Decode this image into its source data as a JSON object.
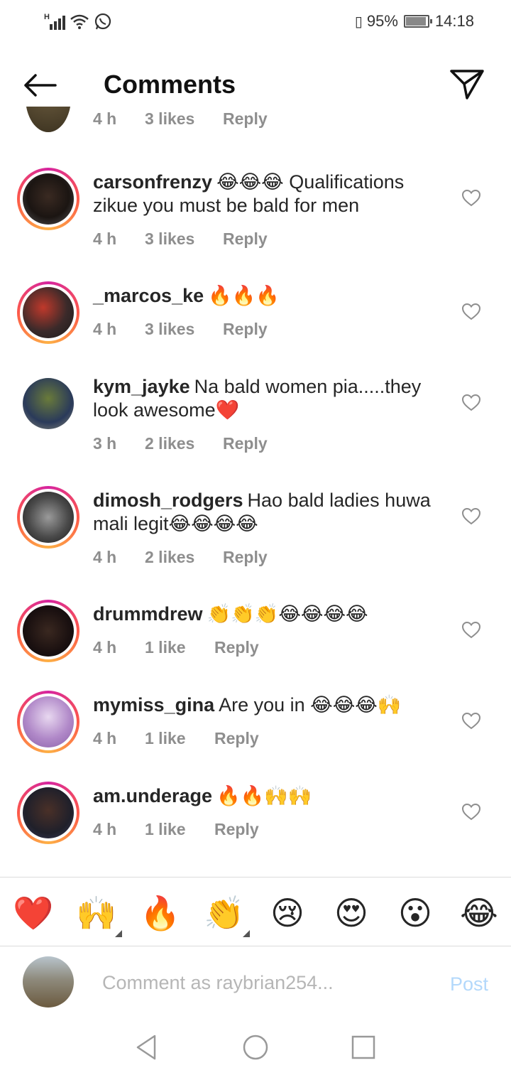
{
  "status_bar": {
    "battery_percent": "95%",
    "time": "14:18",
    "battery_level": 0.95,
    "icons": [
      "signal-icon",
      "wifi-icon",
      "whatsapp-icon",
      "vibrate-icon",
      "battery-icon"
    ]
  },
  "header": {
    "title": "Comments",
    "back_icon": "arrow-left-icon",
    "send_icon": "paper-plane-icon"
  },
  "partial_comment": {
    "time": "4 h",
    "likes": "3 likes",
    "reply": "Reply"
  },
  "comments": [
    {
      "username": "carsonfrenzy",
      "text": "😂😂😂 Qualifications zikue you must be bald for men",
      "time": "4 h",
      "likes": "3 likes",
      "reply": "Reply",
      "story_ring": true
    },
    {
      "username": "_marcos_ke",
      "text": "🔥🔥🔥",
      "time": "4 h",
      "likes": "3 likes",
      "reply": "Reply",
      "story_ring": true
    },
    {
      "username": "kym_jayke",
      "text": "Na bald women pia.....they look awesome❤️",
      "time": "3 h",
      "likes": "2 likes",
      "reply": "Reply",
      "story_ring": false
    },
    {
      "username": "dimosh_rodgers",
      "text": "Hao bald ladies huwa mali legit😂😂😂😂",
      "time": "4 h",
      "likes": "2 likes",
      "reply": "Reply",
      "story_ring": true
    },
    {
      "username": "drummdrew",
      "text": "👏👏👏😂😂😂😂",
      "time": "4 h",
      "likes": "1 like",
      "reply": "Reply",
      "story_ring": true
    },
    {
      "username": "mymiss_gina",
      "text": "Are you in 😂😂😂🙌",
      "time": "4 h",
      "likes": "1 like",
      "reply": "Reply",
      "story_ring": true
    },
    {
      "username": "am.underage",
      "text": "🔥🔥🙌🙌",
      "time": "4 h",
      "likes": "1 like",
      "reply": "Reply",
      "story_ring": true
    }
  ],
  "reactions": [
    "❤️",
    "🙌",
    "🔥",
    "👏",
    "😢",
    "😍",
    "😮",
    "😂"
  ],
  "composer": {
    "placeholder": "Comment as raybrian254...",
    "post_label": "Post"
  },
  "colors": {
    "post_disabled": "#b3d8fb",
    "meta_gray": "#8e8e8e",
    "ring_start": "#d6249f",
    "ring_end": "#fdb045"
  }
}
